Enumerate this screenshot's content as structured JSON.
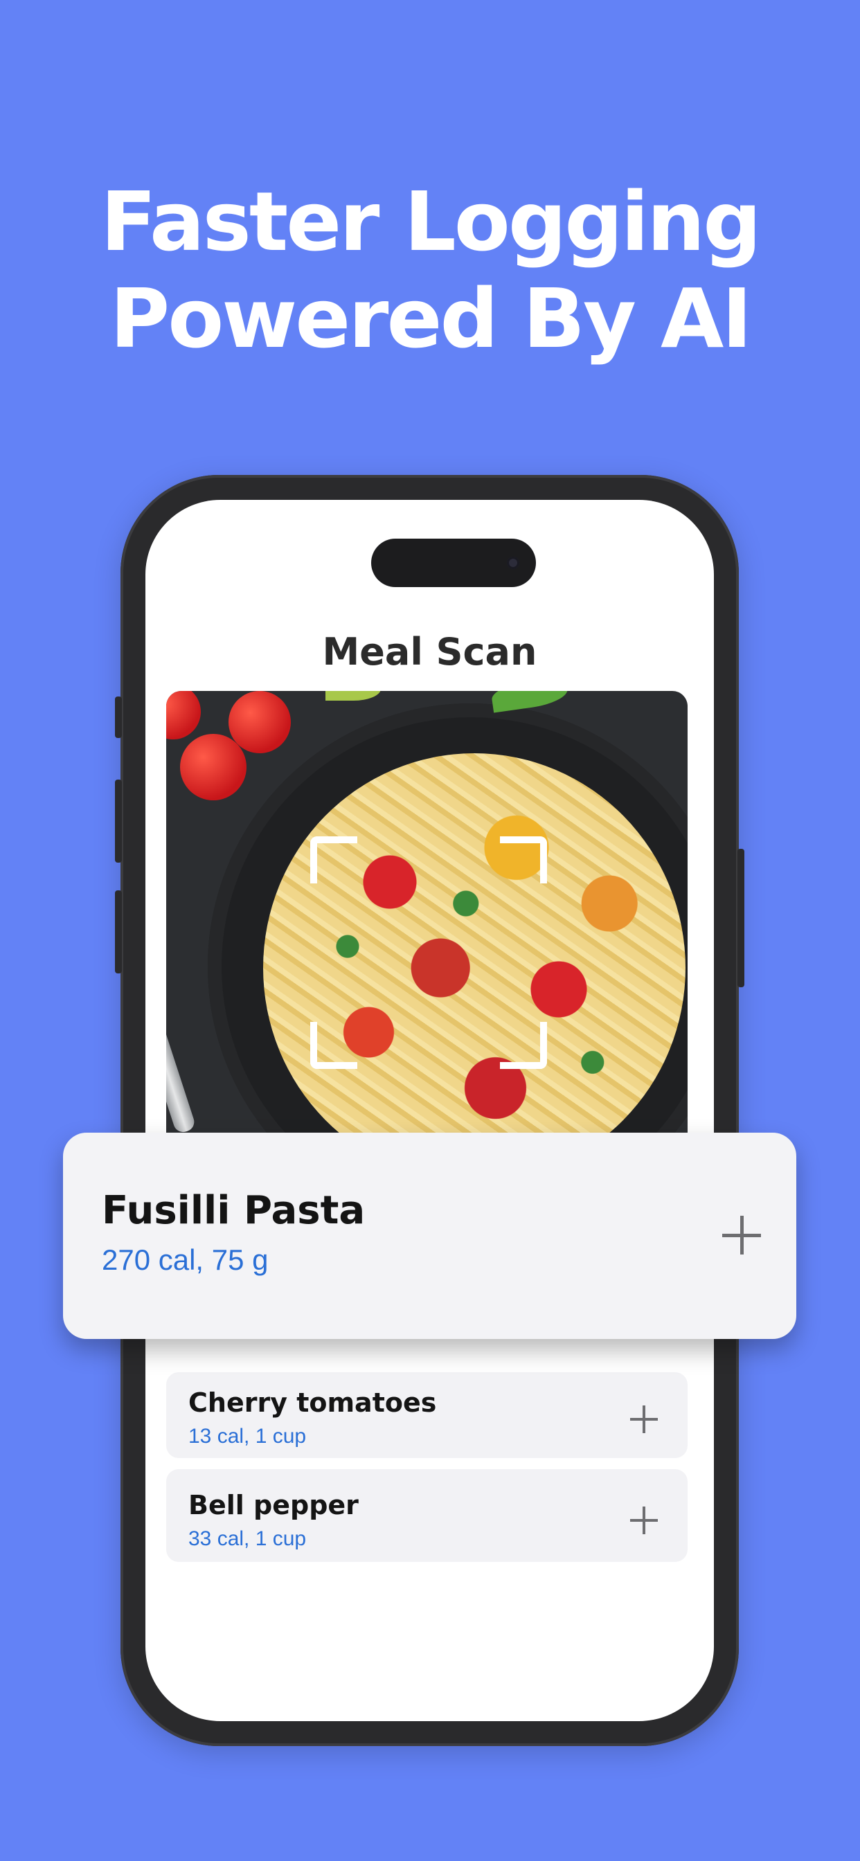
{
  "headline": {
    "line1": "Faster Logging",
    "line2": "Powered By AI"
  },
  "screen": {
    "title": "Meal Scan",
    "photo_alt": "fusilli pasta dish"
  },
  "result_card": {
    "name": "Fusilli Pasta",
    "meta": "270 cal, 75 g"
  },
  "ingredients": [
    {
      "name": "Cherry tomatoes",
      "meta": "13 cal, 1 cup"
    },
    {
      "name": "Bell pepper",
      "meta": "33 cal, 1 cup"
    }
  ],
  "colors": {
    "background": "#6382F6",
    "accent_text": "#2a6fd6",
    "card": "#f3f3f6"
  }
}
